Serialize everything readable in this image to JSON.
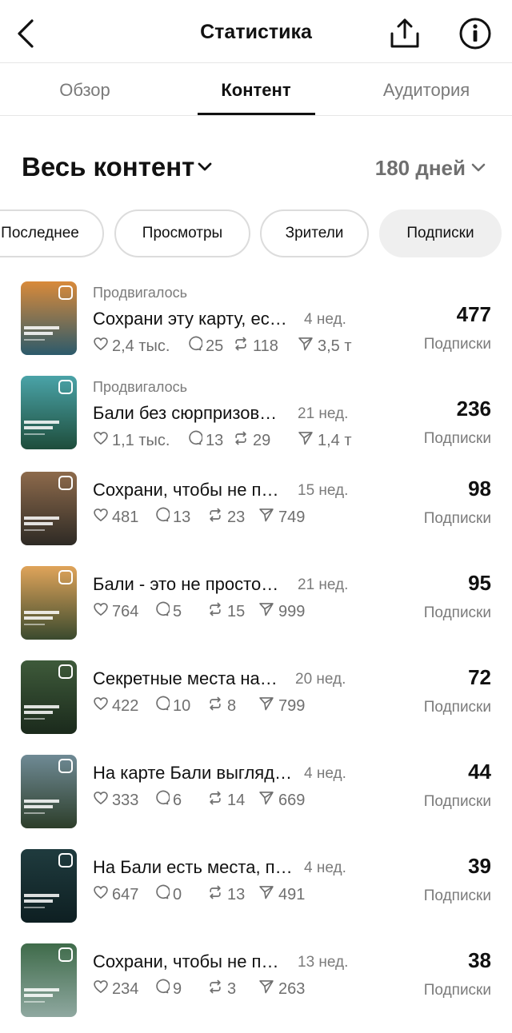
{
  "header": {
    "title": "Статистика"
  },
  "tabs": [
    {
      "label": "Обзор",
      "active": false
    },
    {
      "label": "Контент",
      "active": true
    },
    {
      "label": "Аудитория",
      "active": false
    }
  ],
  "filter": {
    "content_label": "Весь контент",
    "period_label": "180 дней"
  },
  "chips": [
    {
      "label": "Последнее",
      "selected": false
    },
    {
      "label": "Просмотры",
      "selected": false
    },
    {
      "label": "Зрители",
      "selected": false
    },
    {
      "label": "Подписки",
      "selected": true
    }
  ],
  "metric_label": "Подписки",
  "posts": [
    {
      "promoted": "Продвигалось",
      "title": "Сохрани эту карту, ес…",
      "age": "4 нед.",
      "likes": "2,4 тыс.",
      "comments": "25",
      "reposts": "118",
      "shares": "3,5 т",
      "metric": "477",
      "thumb_colors": [
        "#d98a3a",
        "#2c5a6b"
      ]
    },
    {
      "promoted": "Продвигалось",
      "title": "Бали без сюрпризов…",
      "age": "21 нед.",
      "likes": "1,1 тыс.",
      "comments": "13",
      "reposts": "29",
      "shares": "1,4 ты",
      "metric": "236",
      "thumb_colors": [
        "#4aa3a8",
        "#1e4d3b"
      ]
    },
    {
      "promoted": "",
      "title": "Сохрани, чтобы не п…",
      "age": "15 нед.",
      "likes": "481",
      "comments": "13",
      "reposts": "23",
      "shares": "749",
      "metric": "98",
      "thumb_colors": [
        "#8d6a4b",
        "#2e2a25"
      ]
    },
    {
      "promoted": "",
      "title": "Бали - это не просто…",
      "age": "21 нед.",
      "likes": "764",
      "comments": "5",
      "reposts": "15",
      "shares": "999",
      "metric": "95",
      "thumb_colors": [
        "#e0a45a",
        "#3a4a2e"
      ]
    },
    {
      "promoted": "",
      "title": "Секретные места на…",
      "age": "20 нед.",
      "likes": "422",
      "comments": "10",
      "reposts": "8",
      "shares": "799",
      "metric": "72",
      "thumb_colors": [
        "#3e5a3a",
        "#1b2a1c"
      ]
    },
    {
      "promoted": "",
      "title": "На карте Бали выгляд…",
      "age": "4 нед.",
      "likes": "333",
      "comments": "6",
      "reposts": "14",
      "shares": "669",
      "metric": "44",
      "thumb_colors": [
        "#6f8a95",
        "#2d3e2a"
      ]
    },
    {
      "promoted": "",
      "title": "На Бали есть места, п…",
      "age": "4 нед.",
      "likes": "647",
      "comments": "0",
      "reposts": "13",
      "shares": "491",
      "metric": "39",
      "thumb_colors": [
        "#1f3b3e",
        "#0e1f22"
      ]
    },
    {
      "promoted": "",
      "title": "Сохрани, чтобы не п…",
      "age": "13 нед.",
      "likes": "234",
      "comments": "9",
      "reposts": "3",
      "shares": "263",
      "metric": "38",
      "thumb_colors": [
        "#3f6b4a",
        "#8fa8a0"
      ]
    }
  ]
}
